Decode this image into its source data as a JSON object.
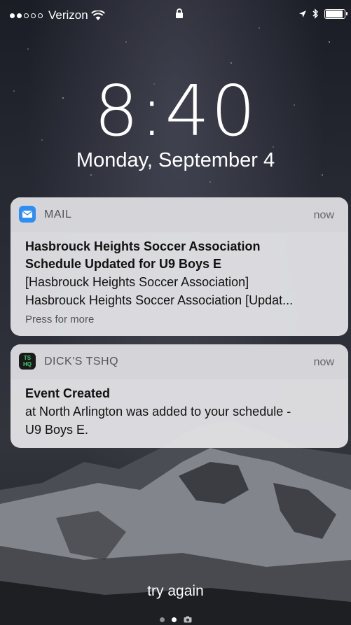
{
  "status_bar": {
    "carrier": "Verizon",
    "signal_bars_filled": 2,
    "signal_bars_total": 5
  },
  "lock_screen": {
    "time": "8:40",
    "date": "Monday, September 4"
  },
  "notifications": [
    {
      "app": "MAIL",
      "time": "now",
      "title_line1": "Hasbrouck Heights Soccer Association",
      "title_line2": "Schedule Updated for U9 Boys E",
      "body_line1": "[Hasbrouck Heights Soccer Association]",
      "body_line2": "Hasbrouck Heights Soccer Association [Updat...",
      "hint": "Press for more"
    },
    {
      "app": "DICK'S TSHQ",
      "time": "now",
      "icon_text": "TS HQ",
      "title": "Event Created",
      "body_line1": "at North Arlington was added to your schedule -",
      "body_line2": "U9 Boys E."
    }
  ],
  "bottom": {
    "label": "try again"
  },
  "colors": {
    "mail_icon": "#2f8ef4",
    "tshq_icon": "#1a1a1a",
    "tshq_icon_text": "#3ecf6a"
  }
}
